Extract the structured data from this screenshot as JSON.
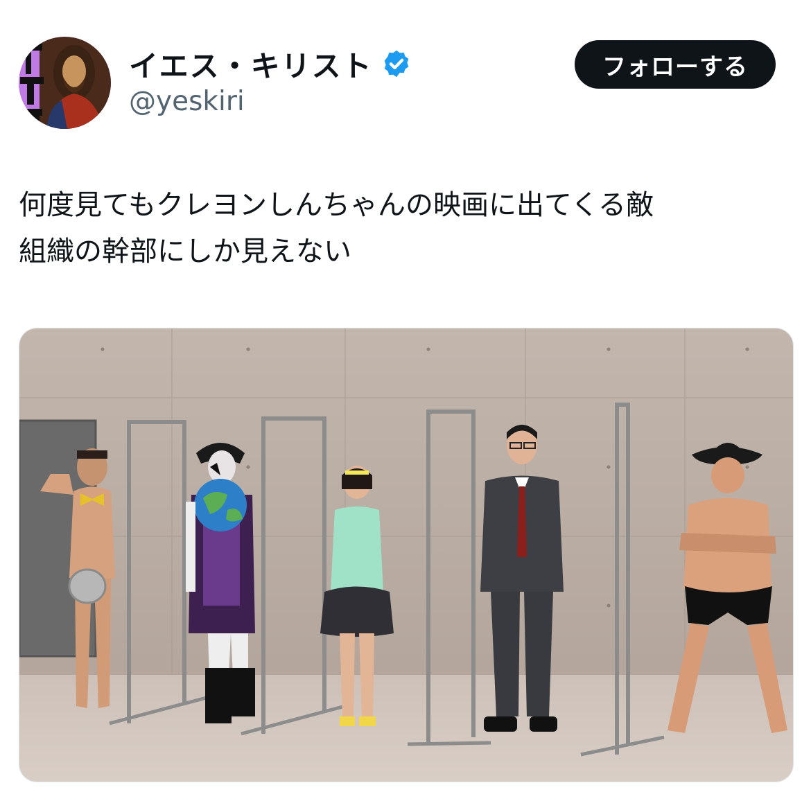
{
  "post": {
    "author": {
      "display_name": "イエス・キリスト",
      "handle": "@yeskiri",
      "verified": true,
      "avatar_icon": "jesus-portrait-avatar"
    },
    "follow_button_label": "フォローする",
    "text_lines": [
      "何度見てもクレヨンしんちゃんの映画に出てくる敵",
      "組織の幹部にしか見えない"
    ],
    "media": {
      "type": "photo"
    }
  },
  "colors": {
    "text_primary": "#0f1419",
    "text_secondary": "#536471",
    "verified_badge": "#1d9bf0",
    "follow_button_bg": "#0f1419",
    "follow_button_text": "#ffffff",
    "avatar_bg": "#c07ae6"
  }
}
